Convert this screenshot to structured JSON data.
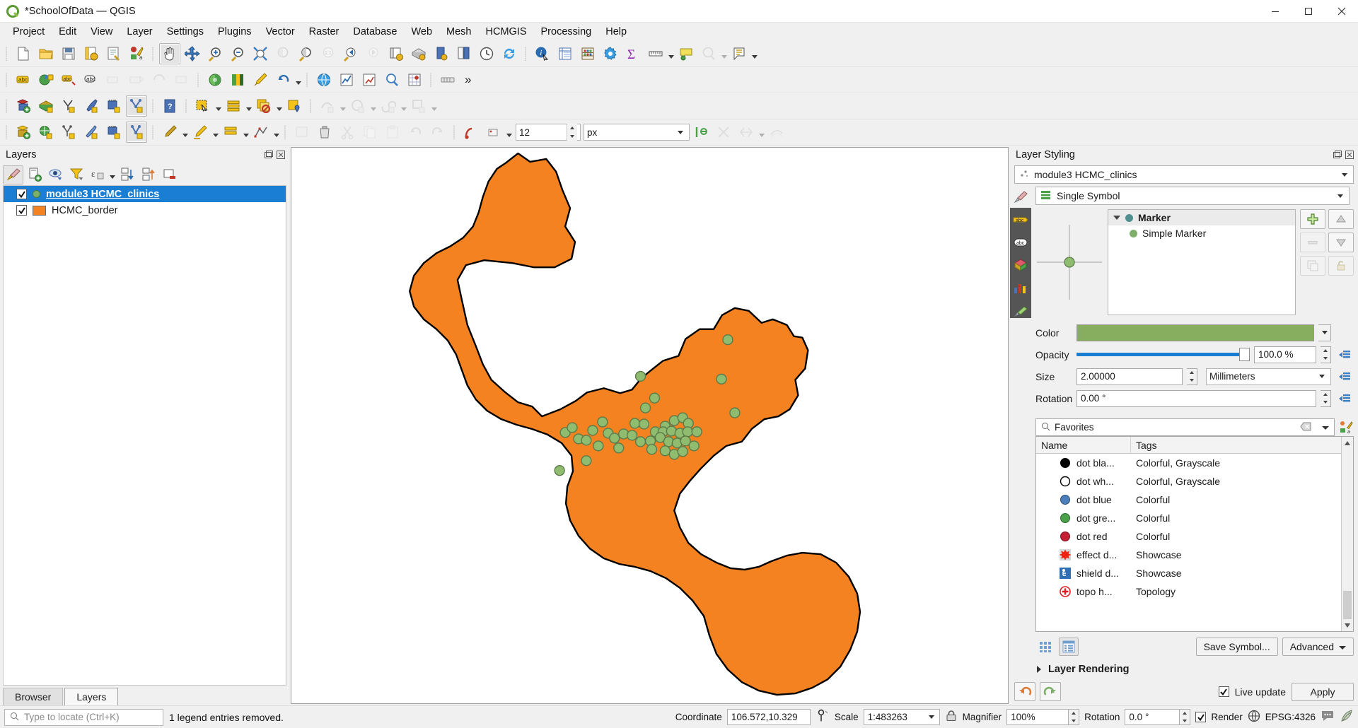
{
  "window": {
    "title": "*SchoolOfData — QGIS",
    "app_icon": "qgis-logo-icon",
    "minimize": "minimize-icon",
    "maximize": "maximize-icon",
    "close": "close-icon"
  },
  "menubar": {
    "items": [
      {
        "label": "Project"
      },
      {
        "label": "Edit"
      },
      {
        "label": "View"
      },
      {
        "label": "Layer"
      },
      {
        "label": "Settings"
      },
      {
        "label": "Plugins"
      },
      {
        "label": "Vector"
      },
      {
        "label": "Raster"
      },
      {
        "label": "Database"
      },
      {
        "label": "Web"
      },
      {
        "label": "Mesh"
      },
      {
        "label": "HCMGIS"
      },
      {
        "label": "Processing"
      },
      {
        "label": "Help"
      }
    ]
  },
  "toolbars": {
    "overflow_label": "»",
    "size_value": "12",
    "units_value": "px"
  },
  "layers_panel": {
    "title": "Layers",
    "items": [
      {
        "name": "module3 HCMC_clinics",
        "checked": true,
        "selected": true,
        "symbol": "point-green"
      },
      {
        "name": "HCMC_border",
        "checked": true,
        "selected": false,
        "symbol": "polygon-orange"
      }
    ],
    "tabs": [
      {
        "label": "Browser",
        "active": false
      },
      {
        "label": "Layers",
        "active": true
      }
    ]
  },
  "layer_styling": {
    "title": "Layer Styling",
    "layer_select": "module3 HCMC_clinics",
    "renderer": "Single Symbol",
    "symbol_tree": [
      {
        "label": "Marker",
        "level": 0,
        "dot_color": "#4f8f90"
      },
      {
        "label": "Simple Marker",
        "level": 1,
        "dot_color": "#7fb069"
      }
    ],
    "properties": {
      "color_label": "Color",
      "color_value": "#87ae5f",
      "opacity_label": "Opacity",
      "opacity_value": "100.0 %",
      "size_label": "Size",
      "size_value": "2.00000",
      "size_unit": "Millimeters",
      "rotation_label": "Rotation",
      "rotation_value": "0.00 °"
    },
    "library": {
      "search_value": "Favorites",
      "col_name": "Name",
      "col_tags": "Tags",
      "rows": [
        {
          "name": "dot  bla...",
          "tags": "Colorful, Grayscale",
          "swatch": "#000000",
          "shape": "circle",
          "stroke": "#000000"
        },
        {
          "name": "dot  wh...",
          "tags": "Colorful, Grayscale",
          "swatch": "#ffffff",
          "shape": "circle",
          "stroke": "#000000"
        },
        {
          "name": "dot blue",
          "tags": "Colorful",
          "swatch": "#4a7ebb",
          "shape": "circle",
          "stroke": "#2b4f78"
        },
        {
          "name": "dot gre...",
          "tags": "Colorful",
          "swatch": "#4aa14a",
          "shape": "circle",
          "stroke": "#2c6b2c"
        },
        {
          "name": "dot red",
          "tags": "Colorful",
          "swatch": "#c42033",
          "shape": "circle",
          "stroke": "#7d1220"
        },
        {
          "name": "effect d...",
          "tags": "Showcase",
          "swatch": "#ee2211",
          "shape": "star",
          "stroke": "#aa1100"
        },
        {
          "name": "shield d...",
          "tags": "Showcase",
          "swatch": "#2f6fb5",
          "shape": "shield",
          "stroke": "#1d4a7d"
        },
        {
          "name": "topo h...",
          "tags": "Topology",
          "swatch": "#ffffff",
          "shape": "cross",
          "stroke": "#e01b24"
        }
      ],
      "save_symbol": "Save Symbol...",
      "advanced": "Advanced"
    },
    "layer_rendering": "Layer Rendering",
    "live_update": "Live update",
    "apply": "Apply"
  },
  "statusbar": {
    "locator_placeholder": "Type to locate (Ctrl+K)",
    "message": "1 legend entries removed.",
    "coordinate_label": "Coordinate",
    "coordinate_value": "106.572,10.329",
    "scale_label": "Scale",
    "scale_value": "1:483263",
    "magnifier_label": "Magnifier",
    "magnifier_value": "100%",
    "rotation_label": "Rotation",
    "rotation_value": "0.0 °",
    "render_label": "Render",
    "crs_label": "EPSG:4326"
  },
  "map": {
    "border_fill": "#f58220",
    "border_stroke": "#000000",
    "point_fill": "#8fbc6e",
    "point_stroke": "#5b7a4a",
    "background": "#ffffff"
  }
}
